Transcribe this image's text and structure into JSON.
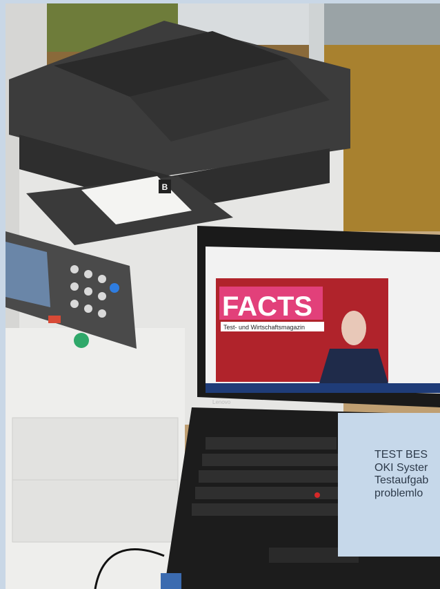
{
  "photo": {
    "alt_subject": "office-printer-with-laptop",
    "laptop_screen": {
      "magazine_title": "FACTS",
      "magazine_subtitle": "Test- und Wirtschaftsmagazin",
      "keyboard_brand": "Lenovo"
    },
    "printer": {
      "paper_tray_label": "B"
    }
  },
  "caption": {
    "lines": [
      "TEST BES",
      "OKI Syster",
      "Testaufgab",
      "problemlo"
    ]
  },
  "colors": {
    "caption_bg": "#c6d8ea",
    "caption_text": "#2d3a4a",
    "facts_pink": "#e2407a",
    "curtain_red": "#b0232b"
  }
}
